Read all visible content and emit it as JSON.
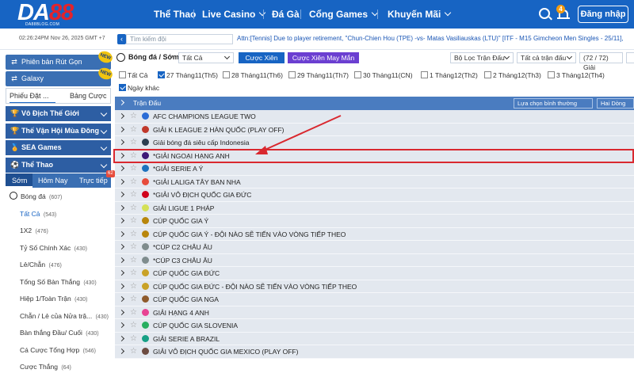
{
  "header": {
    "logo_main": "DA",
    "logo_accent": "88",
    "logo_sub": "DA88BLOG.COM",
    "nav": [
      "Thể Thao",
      "Live Casino",
      "Đá Gà",
      "Cổng Games",
      "Khuyến Mãi"
    ],
    "notif_count": "4",
    "login_label": "Đăng nhập",
    "icons": [
      "search-icon",
      "bell-icon"
    ]
  },
  "topbar": {
    "timestamp": "02:26:24PM Nov 26, 2025 GMT +7",
    "search_placeholder": "Tìm kiếm đội",
    "ticker": "Attn:[Tennis] Due to player retirement, \"Chun-Chien Hou (TPE) -vs- Matas Vasiliauskas (LTU)\" [ITF - M15 Gimcheon Men Singles - 25/11],"
  },
  "sidebar": {
    "quick_version": "Phiên bản Rút Gọn",
    "galaxy": "Galaxy",
    "new_badge": "NEW",
    "tabs": [
      "Phiếu Đặt ...",
      "Bảng Cược"
    ],
    "sections": [
      "Vô Địch Thế Giới",
      "Thế Vận Hội Mùa Đông",
      "SEA Games",
      "Thể Thao"
    ],
    "sub_tabs": [
      "Sớm",
      "Hôm Nay",
      "Trực tiếp"
    ],
    "live_badge": "62",
    "sport": {
      "label": "Bóng đá",
      "count": "(607)"
    },
    "items": [
      {
        "label": "Tất Cả",
        "count": "(543)"
      },
      {
        "label": "1X2",
        "count": "(476)"
      },
      {
        "label": "Tỷ Số Chính Xác",
        "count": "(430)"
      },
      {
        "label": "Lẻ/Chẵn",
        "count": "(476)"
      },
      {
        "label": "Tổng Số Bàn Thắng",
        "count": "(430)"
      },
      {
        "label": "Hiệp 1/Toàn Trận",
        "count": "(430)"
      },
      {
        "label": "Chẵn / Lẻ của Nửa trậ...",
        "count": "(430)"
      },
      {
        "label": "Bàn thắng Đầu/ Cuối",
        "count": "(430)"
      },
      {
        "label": "Cá Cược Tổng Hợp",
        "count": "(546)"
      },
      {
        "label": "Cược Thắng",
        "count": "(64)"
      }
    ]
  },
  "filters": {
    "title": "Bóng đá / Sớm",
    "market": "Tất Cả",
    "parlay": "Cược Xiên",
    "lucky_parlay": "Cược Xiên May Mắn",
    "match_filter": "Bộ Lọc Trận Đấu",
    "all_matches": "Tất cả trận đấu",
    "league_count": "(72 / 72) Giải",
    "dates": [
      {
        "label": "Tất Cả",
        "checked": false
      },
      {
        "label": "27 Tháng11(Th5)",
        "checked": true
      },
      {
        "label": "28 Tháng11(Th6)",
        "checked": false
      },
      {
        "label": "29 Tháng11(Th7)",
        "checked": false
      },
      {
        "label": "30 Tháng11(CN)",
        "checked": false
      },
      {
        "label": "1 Tháng12(Th2)",
        "checked": false
      },
      {
        "label": "2 Tháng12(Th3)",
        "checked": false
      },
      {
        "label": "3 Tháng12(Th4)",
        "checked": false
      },
      {
        "label": "Ngày khác",
        "checked": true
      }
    ]
  },
  "table": {
    "header": "Trận Đấu",
    "sort": "Lựa chọn bình thường",
    "view": "Hai Dòng",
    "leagues": [
      {
        "name": "AFC CHAMPIONS LEAGUE TWO",
        "color": "#2b6cd6"
      },
      {
        "name": "GIẢI K LEAGUE 2 HÀN QUỐC (PLAY OFF)",
        "color": "#c0392b"
      },
      {
        "name": "Giải bóng đá siêu cấp Indonesia",
        "color": "#2c3e50"
      },
      {
        "name": "*GIẢI NGOẠI HẠNG ANH",
        "color": "#3d1a78"
      },
      {
        "name": "*GIẢI SERIE A Ý",
        "color": "#1e73be"
      },
      {
        "name": "*GIẢI LALIGA TÂY BAN NHA",
        "color": "#e74c3c"
      },
      {
        "name": "*GIẢI VÔ ĐỊCH QUỐC GIA ĐỨC",
        "color": "#d0021b"
      },
      {
        "name": "GIẢI LIGUE 1 PHÁP",
        "color": "#d4e157"
      },
      {
        "name": "CÚP QUỐC GIA Ý",
        "color": "#b8860b"
      },
      {
        "name": "CÚP QUỐC GIA Ý - ĐỘI NÀO SẼ TIẾN VÀO VÒNG TIẾP THEO",
        "color": "#b8860b"
      },
      {
        "name": "*CÚP C2 CHÂU ÂU",
        "color": "#7f8c8d"
      },
      {
        "name": "*CÚP C3 CHÂU ÂU",
        "color": "#7f8c8d"
      },
      {
        "name": "CÚP QUỐC GIA ĐỨC",
        "color": "#c9a227"
      },
      {
        "name": "CÚP QUỐC GIA ĐỨC - ĐỘI NÀO SẼ TIẾN VÀO VÒNG TIẾP THEO",
        "color": "#c9a227"
      },
      {
        "name": "CÚP QUỐC GIA NGA",
        "color": "#8e5a2b"
      },
      {
        "name": "GIẢI HẠNG 4 ANH",
        "color": "#e84393"
      },
      {
        "name": "CÚP QUỐC GIA SLOVENIA",
        "color": "#27ae60"
      },
      {
        "name": "GIẢI SERIE A BRAZIL",
        "color": "#16a085"
      },
      {
        "name": "GIẢI VÔ ĐỊCH QUỐC GIA MEXICO (PLAY OFF)",
        "color": "#6d4c41"
      }
    ]
  },
  "colors": {
    "brand": "#1764c3",
    "highlight": "#d9282f",
    "row_bg": "#e3e8ef"
  }
}
